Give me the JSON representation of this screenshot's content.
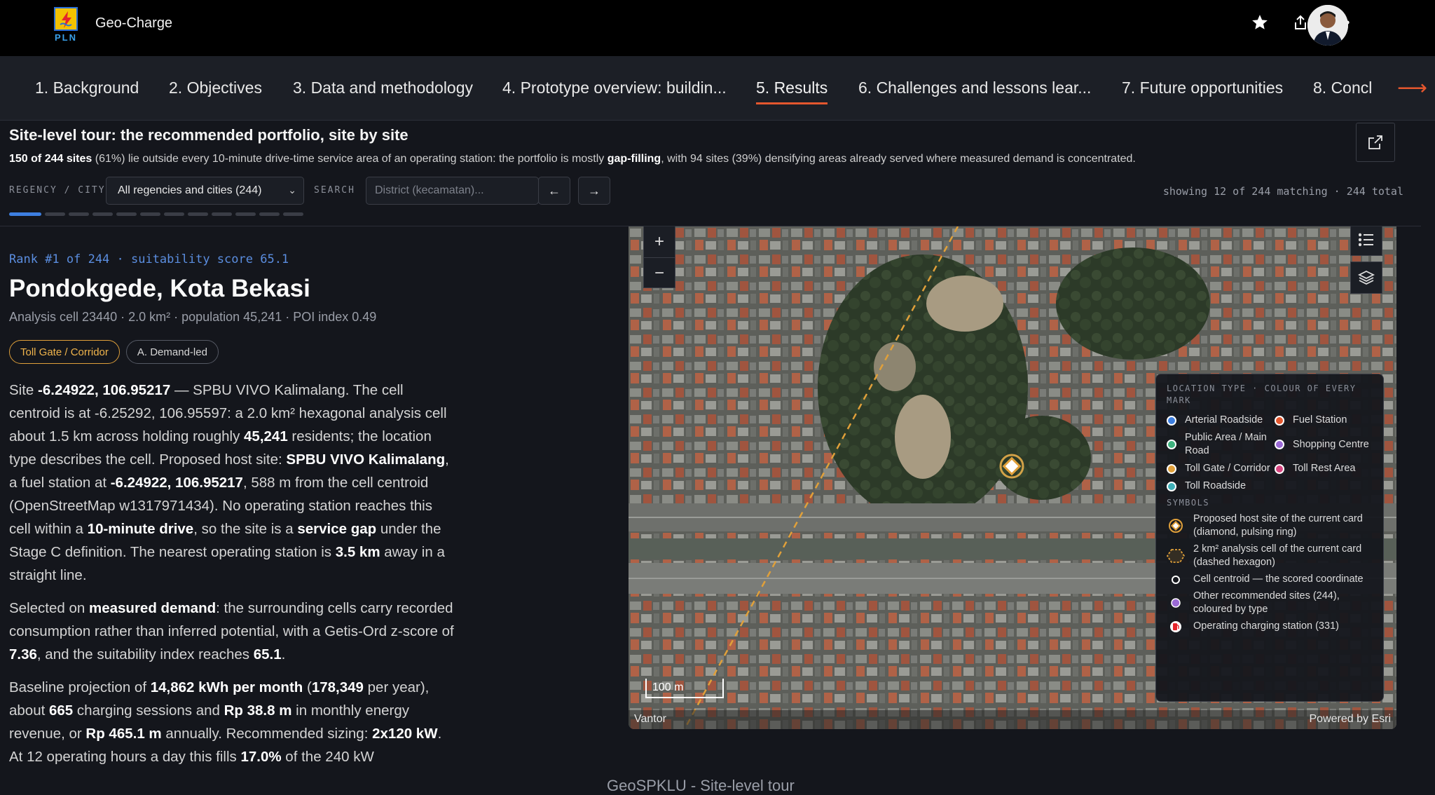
{
  "app": {
    "logo_text": "PLN",
    "title": "Geo-Charge"
  },
  "header_actions": [
    "star-icon",
    "share-icon",
    "more-icon"
  ],
  "tabs": [
    {
      "label": "1. Background"
    },
    {
      "label": "2. Objectives"
    },
    {
      "label": "3. Data and methodology"
    },
    {
      "label": "4. Prototype overview: buildin..."
    },
    {
      "label": "5. Results"
    },
    {
      "label": "6. Challenges and lessons lear..."
    },
    {
      "label": "7. Future opportunities"
    },
    {
      "label": "8. Concl"
    }
  ],
  "active_tab": 4,
  "section": {
    "title": "Site-level tour: the recommended portfolio, site by site",
    "sub_strong1": "150 of 244 sites",
    "sub_text1": " (61%) lie outside every 10-minute drive-time service area of an operating station: the portfolio is mostly ",
    "sub_strong2": "gap-filling",
    "sub_text2": ", with 94 sites (39%) densifying areas already served where measured demand is concentrated."
  },
  "filters": {
    "regency_label": "REGENCY / CITY",
    "regency_value": "All regencies and cities (244)",
    "search_label": "SEARCH",
    "search_placeholder": "District (kecamatan)...",
    "prev": "←",
    "next": "→",
    "showing": "showing 12 of 244 matching · 244 total"
  },
  "pager": {
    "total": 12,
    "current": 1
  },
  "card": {
    "rank": "Rank #1 of 244 · suitability score 65.1",
    "name": "Pondokgede, Kota Bekasi",
    "meta": "Analysis cell 23440 · 2.0 km² · population 45,241 · POI index 0.49",
    "badge_type": "Toll Gate / Corridor",
    "badge_mode": "A. Demand-led",
    "p1": {
      "a": "Site ",
      "b": "-6.24922, 106.95217",
      "c": " — SPBU VIVO Kalimalang. The cell centroid is at -6.25292, 106.95597: a 2.0 km² hexagonal analysis cell about 1.5 km across holding roughly ",
      "d": "45,241",
      "e": " residents; the location type describes the cell. Proposed host site: ",
      "f": "SPBU VIVO Kalimalang",
      "g": ", a fuel station at ",
      "h": "-6.24922, 106.95217",
      "i": ", 588 m from the cell centroid (OpenStreetMap w1317971434). No operating station reaches this cell within a ",
      "j": "10-minute drive",
      "k": ", so the site is a ",
      "l": "service gap",
      "m": " under the Stage C definition. The nearest operating station is ",
      "n": "3.5 km",
      "o": " away in a straight line."
    },
    "p2": {
      "a": "Selected on ",
      "b": "measured demand",
      "c": ": the surrounding cells carry recorded consumption rather than inferred potential, with a Getis-Ord z-score of ",
      "d": "7.36",
      "e": ", and the suitability index reaches ",
      "f": "65.1",
      "g": "."
    },
    "p3": {
      "a": "Baseline projection of ",
      "b": "14,862 kWh per month",
      "c": " (",
      "d": "178,349",
      "e": " per year), about ",
      "f": "665",
      "g": " charging sessions and ",
      "h": "Rp 38.8 m",
      "i": " in monthly energy revenue, or ",
      "j": "Rp 465.1 m",
      "k": " annually. Recommended sizing: ",
      "l": "2x120 kW",
      "m": ". At 12 operating hours a day this fills ",
      "n": "17.0%",
      "o": " of the 240 kW"
    }
  },
  "map": {
    "zoom_in": "+",
    "zoom_out": "−",
    "scale": "100 m",
    "attribution_left": "Vantor",
    "attribution_right": "Powered by Esri",
    "legend": {
      "header1": "LOCATION TYPE · COLOUR OF EVERY MARK",
      "types": [
        {
          "label": "Arterial Roadside",
          "color": "#3d7fe0"
        },
        {
          "label": "Fuel Station",
          "color": "#e4572e"
        },
        {
          "label": "Public Area / Main Road",
          "color": "#3fb27f"
        },
        {
          "label": "Shopping Centre",
          "color": "#9b6ad6"
        },
        {
          "label": "Toll Gate / Corridor",
          "color": "#e0a03a"
        },
        {
          "label": "Toll Rest Area",
          "color": "#d6457f"
        },
        {
          "label": "Toll Roadside",
          "color": "#3fb0b8"
        }
      ],
      "header2": "SYMBOLS",
      "symbols": [
        {
          "label": "Proposed host site of the current card (diamond, pulsing ring)"
        },
        {
          "label": "2 km² analysis cell of the current card (dashed hexagon)"
        },
        {
          "label": "Cell centroid — the scored coordinate"
        },
        {
          "label": "Other recommended sites (244), coloured by type"
        },
        {
          "label": "Operating charging station (331)"
        }
      ]
    }
  },
  "footer_caption": "GeoSPKLU - Site-level tour"
}
